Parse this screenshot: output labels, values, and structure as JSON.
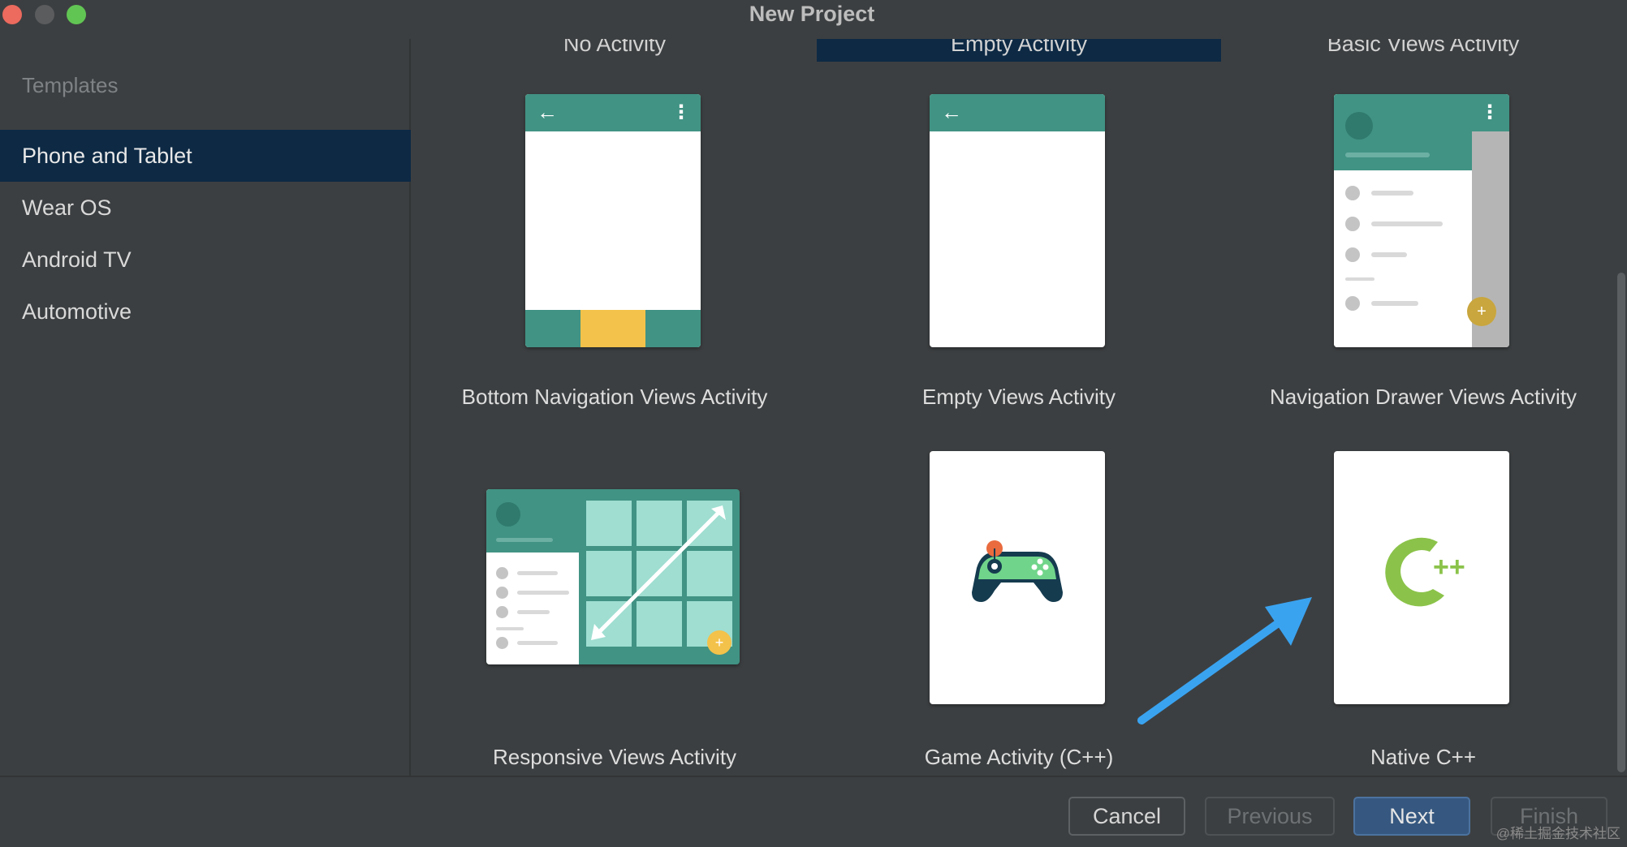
{
  "window": {
    "title": "New Project"
  },
  "sidebar": {
    "heading": "Templates",
    "items": [
      {
        "label": "Phone and Tablet",
        "selected": true
      },
      {
        "label": "Wear OS",
        "selected": false
      },
      {
        "label": "Android TV",
        "selected": false
      },
      {
        "label": "Automotive",
        "selected": false
      }
    ]
  },
  "templates": {
    "top_row": [
      "No Activity",
      "Empty Activity",
      "Basic Views Activity"
    ],
    "cards": [
      {
        "label": "Bottom Navigation Views Activity",
        "icon": "bottom-navigation-preview"
      },
      {
        "label": "Empty Views Activity",
        "icon": "empty-views-preview"
      },
      {
        "label": "Navigation Drawer Views Activity",
        "icon": "navigation-drawer-preview"
      },
      {
        "label": "Responsive Views Activity",
        "icon": "responsive-views-preview"
      },
      {
        "label": "Game Activity (C++)",
        "icon": "gamepad-icon"
      },
      {
        "label": "Native C++",
        "icon": "cpp-logo-icon",
        "cpp_text": "C",
        "cpp_plus": "++"
      }
    ]
  },
  "footer": {
    "cancel": "Cancel",
    "previous": "Previous",
    "next": "Next",
    "finish": "Finish",
    "watermark": "@稀土掘金技术社区"
  },
  "colors": {
    "background": "#3c3f41",
    "selection": "#0d2944",
    "teal": "#419384",
    "yellow": "#f3c24a",
    "primary_button": "#365880",
    "annotation_arrow": "#3aa3f0",
    "cpp_green": "#8bc34a"
  }
}
